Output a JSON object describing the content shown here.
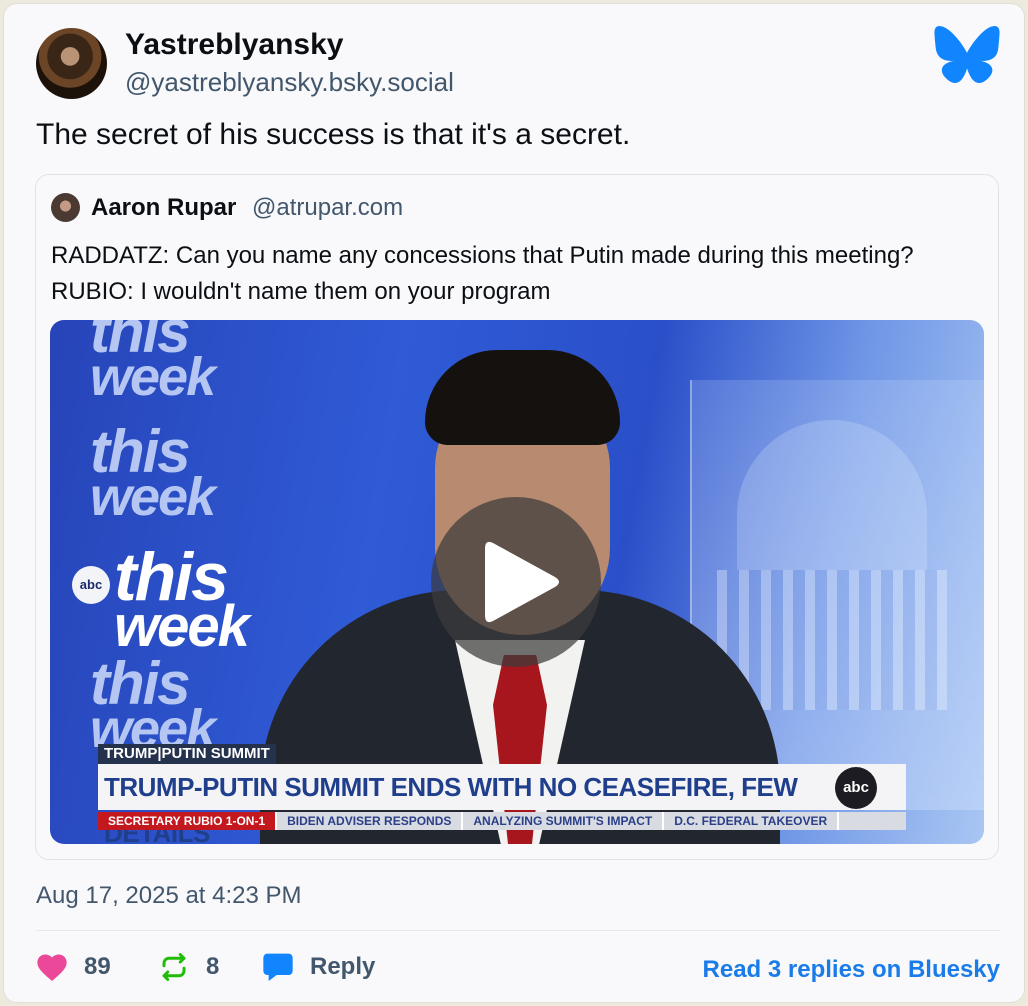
{
  "post": {
    "author_name": "Yastreblyansky",
    "author_handle": "@yastreblyansky.bsky.social",
    "text": "The secret of his success is that it's a secret.",
    "timestamp": "Aug 17, 2025 at 4:23 PM"
  },
  "quote": {
    "author_name": "Aaron Rupar",
    "author_handle": "@atrupar.com",
    "line1": "RADDATZ: Can you name any concessions that Putin made during this meeting?",
    "line2": "RUBIO: I wouldn't name them on your program"
  },
  "video": {
    "brand_this": "this",
    "brand_week": "week",
    "abc_small": "abc",
    "ticker_label": "TRUMP|PUTIN SUMMIT",
    "headline": "TRUMP-PUTIN SUMMIT ENDS WITH NO CEASEFIRE, FEW DETAILS",
    "abc_logo": "abc",
    "ticker_items": [
      "SECRETARY RUBIO 1-ON-1",
      "BIDEN ADVISER RESPONDS",
      "ANALYZING SUMMIT'S IMPACT",
      "D.C. FEDERAL TAKEOVER"
    ]
  },
  "actions": {
    "likes": "89",
    "reposts": "8",
    "reply_label": "Reply",
    "read_replies": "Read 3 replies on Bluesky"
  },
  "colors": {
    "bluesky_blue": "#1185fe",
    "like_pink": "#ec4899",
    "repost_green": "#20bc07",
    "link_blue": "#1a7ce8"
  }
}
